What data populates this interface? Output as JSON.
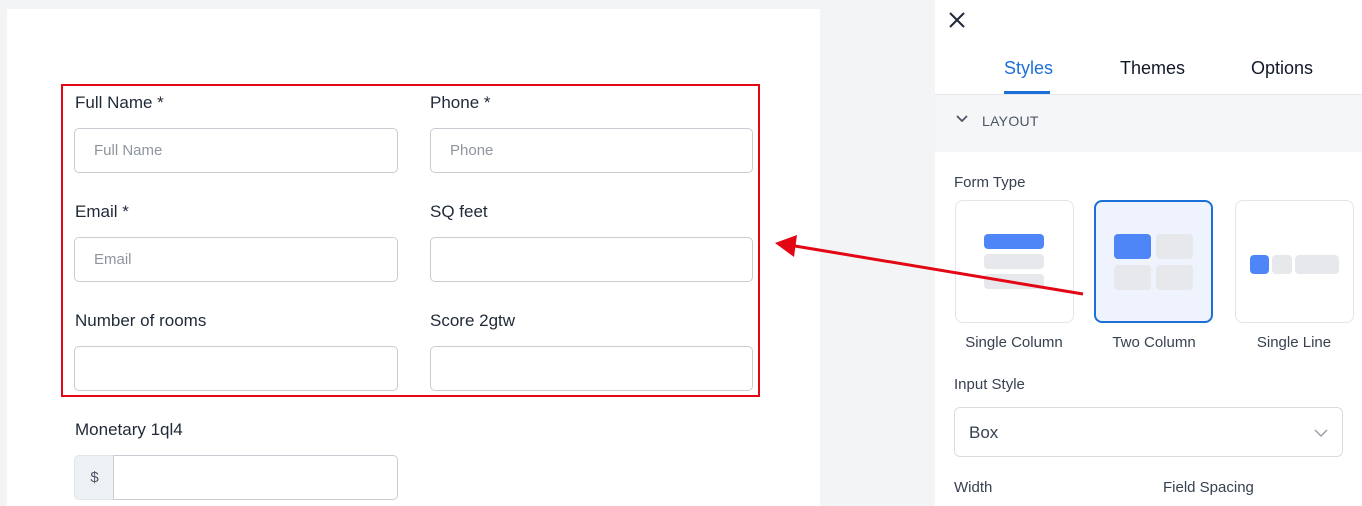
{
  "form": {
    "fields": [
      {
        "label": "Full Name *",
        "placeholder": "Full Name"
      },
      {
        "label": "Phone *",
        "placeholder": "Phone"
      },
      {
        "label": "Email *",
        "placeholder": "Email"
      },
      {
        "label": "SQ feet",
        "placeholder": ""
      },
      {
        "label": "Number of rooms",
        "placeholder": ""
      },
      {
        "label": "Score 2gtw",
        "placeholder": ""
      },
      {
        "label": "Monetary 1ql4",
        "placeholder": "",
        "prefix": "$"
      }
    ]
  },
  "panel": {
    "close_icon": "close-icon",
    "tabs": [
      {
        "label": "Styles",
        "active": true
      },
      {
        "label": "Themes",
        "active": false
      },
      {
        "label": "Options",
        "active": false
      }
    ],
    "section": {
      "title": "LAYOUT",
      "icon": "chevron-down-icon"
    },
    "form_type": {
      "label": "Form Type",
      "options": [
        {
          "label": "Single Column",
          "selected": false
        },
        {
          "label": "Two Column",
          "selected": true
        },
        {
          "label": "Single Line",
          "selected": false
        }
      ]
    },
    "input_style": {
      "label": "Input Style",
      "value": "Box"
    },
    "width": {
      "label": "Width"
    },
    "field_spacing": {
      "label": "Field Spacing"
    }
  },
  "annotation": {
    "color": "#e30613"
  },
  "colors": {
    "accent": "#1d6fd8",
    "layout_block": "#4f86f7"
  }
}
